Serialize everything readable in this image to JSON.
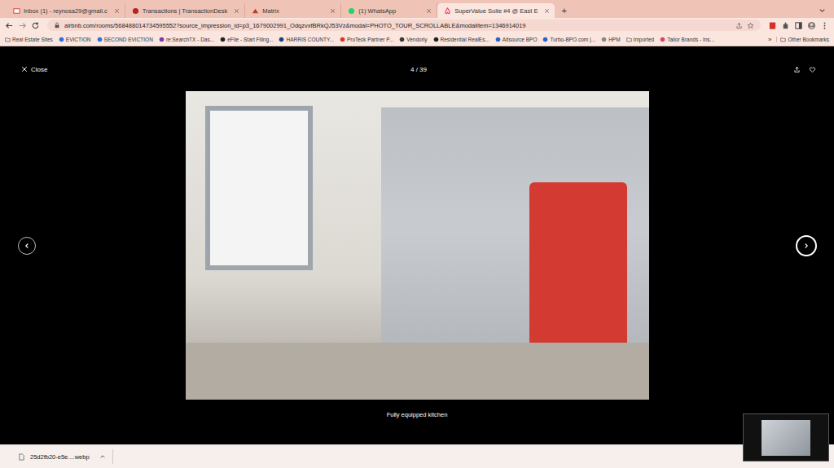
{
  "tabs": [
    {
      "label": "Inbox (1) - reynosa29@gmail.c",
      "selected": false,
      "kind": "gmail"
    },
    {
      "label": "Transactions | TransactionDesk",
      "selected": false,
      "kind": "desk"
    },
    {
      "label": "Matrix",
      "selected": false,
      "kind": "matrix"
    },
    {
      "label": "(1) WhatsApp",
      "selected": false,
      "kind": "whatsapp"
    },
    {
      "label": "SuperValue Suite #4 @ East E",
      "selected": true,
      "kind": "airbnb"
    }
  ],
  "new_tab": "+",
  "address_bar": {
    "url": "airbnb.com/rooms/568488014734595552?source_impression_id=p3_1679002991_OdqzvxfBRkQJ53Vz&modal=PHOTO_TOUR_SCROLLABLE&modalItem=1346914019"
  },
  "bookmarks": [
    {
      "label": "Real Estate Sites",
      "kind": "folder",
      "color": "#555555"
    },
    {
      "label": "EVICTION",
      "kind": "link",
      "color": "#2f6fd6"
    },
    {
      "label": "SECOND EVICTION",
      "kind": "link",
      "color": "#2f6fd6"
    },
    {
      "label": "re:SearchTX - Das...",
      "kind": "link",
      "color": "#7a3ca8"
    },
    {
      "label": "eFile - Start Filing...",
      "kind": "link",
      "color": "#222222"
    },
    {
      "label": "HARRIS COUNTY...",
      "kind": "link",
      "color": "#1d3f8a"
    },
    {
      "label": "ProTeck Partner P...",
      "kind": "link",
      "color": "#d33a2c"
    },
    {
      "label": "Vendorly",
      "kind": "link",
      "color": "#3b3b3b"
    },
    {
      "label": "Residential RealEs...",
      "kind": "link",
      "color": "#222222"
    },
    {
      "label": "Altsource BPO",
      "kind": "link",
      "color": "#2a62c9"
    },
    {
      "label": "Turbo-BPO.com |...",
      "kind": "link",
      "color": "#2a62c9"
    },
    {
      "label": "HPM",
      "kind": "link",
      "color": "#888888"
    },
    {
      "label": "Imported",
      "kind": "folder",
      "color": "#555555"
    },
    {
      "label": "Tailor Brands - Ins...",
      "kind": "link",
      "color": "#d8456b"
    }
  ],
  "bookmarks_overflow": "»",
  "other_bookmarks": "Other Bookmarks",
  "photo_tour": {
    "close": "Close",
    "counter": "4 / 39",
    "caption": "Fully equipped kitchen",
    "nav_buttons": [
      {
        "kind": "prev",
        "focused": false
      },
      {
        "kind": "next",
        "focused": true
      }
    ]
  },
  "download": {
    "filename": "25d2fb20-e5e....webp"
  }
}
